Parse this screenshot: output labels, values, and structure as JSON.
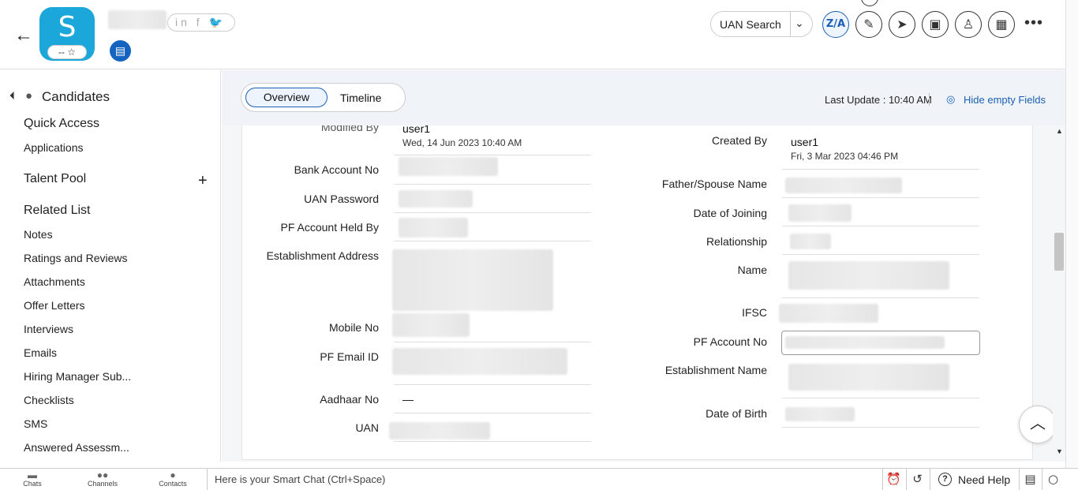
{
  "header": {
    "avatar_letter": "S",
    "avatar_rating": "-- ☆",
    "social": "in f 🐦",
    "uan_search": "UAN Search",
    "translate_label": "Z/A"
  },
  "sidebar": {
    "title": "Candidates",
    "quick_access": "Quick Access",
    "applications": "Applications",
    "talent_pool": "Talent Pool",
    "related_list": "Related List",
    "items": [
      "Notes",
      "Ratings and Reviews",
      "Attachments",
      "Offer Letters",
      "Interviews",
      "Emails",
      "Hiring Manager Sub...",
      "Checklists",
      "SMS",
      "Answered Assessm..."
    ]
  },
  "toolbar": {
    "tab_overview": "Overview",
    "tab_timeline": "Timeline",
    "last_update": "Last Update : 10:40 AM",
    "hide_empty": "Hide empty Fields"
  },
  "fields_left": {
    "modified_by_label": "Modified By",
    "modified_by_value": "user1",
    "modified_by_date": "Wed, 14 Jun 2023 10:40 AM",
    "bank_account_label": "Bank Account No",
    "uan_password_label": "UAN Password",
    "pf_held_by_label": "PF Account Held By",
    "establishment_address_label": "Establishment Address",
    "mobile_label": "Mobile No",
    "pf_email_label": "PF Email ID",
    "aadhaar_label": "Aadhaar No",
    "aadhaar_value": "—",
    "uan_label": "UAN"
  },
  "fields_right": {
    "created_by_label": "Created By",
    "created_by_value": "user1",
    "created_by_date": "Fri, 3 Mar 2023 04:46 PM",
    "father_spouse_label": "Father/Spouse Name",
    "date_joining_label": "Date of Joining",
    "relationship_label": "Relationship",
    "name_label": "Name",
    "ifsc_label": "IFSC",
    "pf_account_label": "PF Account No",
    "establishment_name_label": "Establishment Name",
    "dob_label": "Date of Birth"
  },
  "bottombar": {
    "chats": "Chats",
    "channels": "Channels",
    "contacts": "Contacts",
    "smart_chat": "Here is your Smart Chat (Ctrl+Space)",
    "need_help": "Need Help"
  },
  "colors": {
    "accent": "#1a5fb4",
    "avatar": "#1ba7d9"
  }
}
